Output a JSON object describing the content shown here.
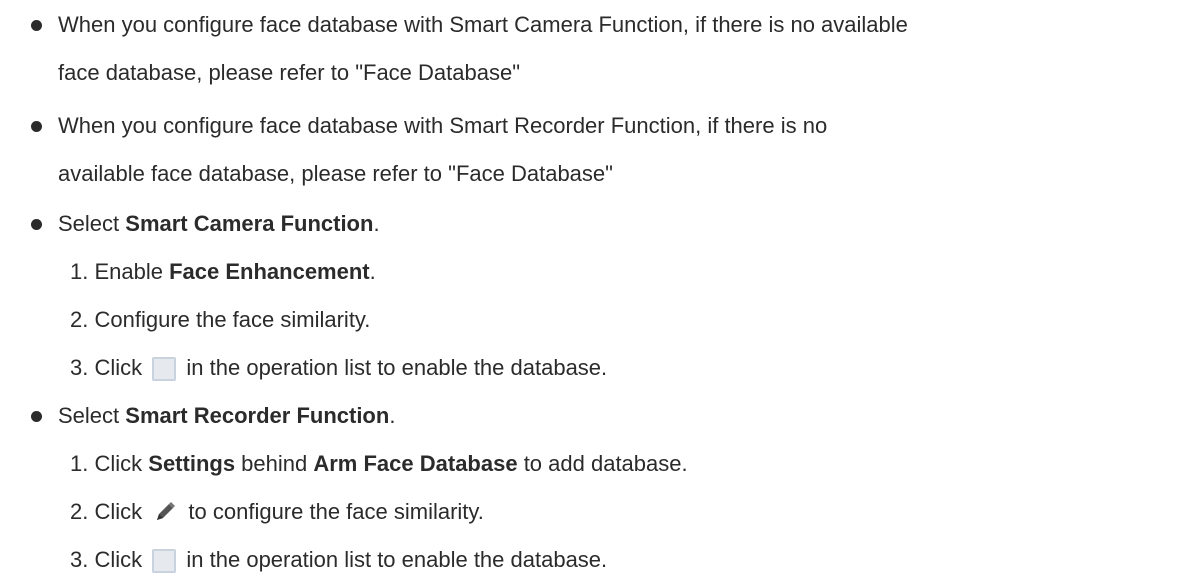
{
  "bullets": [
    {
      "line1": "When you configure face database with Smart Camera Function, if there is no available",
      "line2": "face database, please refer to \"Face Database\""
    },
    {
      "line1": "When you configure face database with Smart Recorder Function, if there is no",
      "line2": "available face database, please refer to \"Face Database\""
    }
  ],
  "camera": {
    "select_prefix": "Select ",
    "select_bold": "Smart Camera Function",
    "select_suffix": ".",
    "steps": [
      {
        "num": "1.",
        "prefix": "Enable ",
        "bold": "Face Enhancement",
        "suffix": "."
      },
      {
        "num": "2.",
        "text": "Configure the face similarity."
      },
      {
        "num": "3.",
        "prefix": "Click",
        "suffix": "in the operation list to enable the database.",
        "icon": "checkbox-icon"
      }
    ]
  },
  "recorder": {
    "select_prefix": "Select ",
    "select_bold": "Smart Recorder Function",
    "select_suffix": ".",
    "steps": [
      {
        "num": "1.",
        "prefix": "Click ",
        "bold1": "Settings",
        "mid": " behind ",
        "bold2": "Arm Face Database",
        "suffix": " to add database."
      },
      {
        "num": "2.",
        "prefix": "Click",
        "suffix": "to configure the face similarity.",
        "icon": "pencil-icon"
      },
      {
        "num": "3.",
        "prefix": "Click",
        "suffix": "in the operation list to enable the database.",
        "icon": "checkbox-icon"
      }
    ]
  }
}
